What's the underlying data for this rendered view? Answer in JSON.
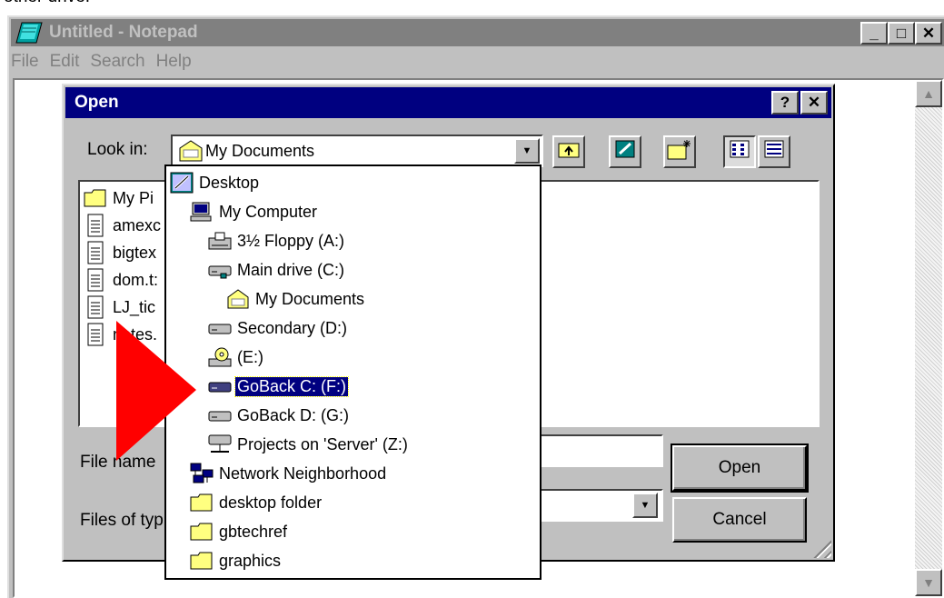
{
  "caption": "other drive.",
  "notepad": {
    "title": "Untitled - Notepad",
    "menu": [
      "File",
      "Edit",
      "Search",
      "Help"
    ],
    "window_buttons": [
      "_",
      "□",
      "✕"
    ]
  },
  "dialog": {
    "title": "Open",
    "title_buttons": [
      "?",
      "✕"
    ],
    "look_in_label": "Look in:",
    "look_in_value": "My Documents",
    "file_name_label": "File name",
    "files_of_type_label": "Files of typ",
    "open_button": "Open",
    "cancel_button": "Cancel",
    "files": [
      {
        "label": "My Pi",
        "icon": "folder-icon"
      },
      {
        "label": "amexc",
        "icon": "text-file-icon"
      },
      {
        "label": "bigtex",
        "icon": "text-file-icon"
      },
      {
        "label": "dom.t:",
        "icon": "text-file-icon"
      },
      {
        "label": "LJ_tic",
        "icon": "text-file-icon"
      },
      {
        "label": "notes.",
        "icon": "text-file-icon"
      }
    ]
  },
  "dropdown": {
    "items": [
      {
        "label": "Desktop",
        "icon": "desktop-icon",
        "indent": 0
      },
      {
        "label": "My Computer",
        "icon": "computer-icon",
        "indent": 1
      },
      {
        "label": "3½ Floppy (A:)",
        "icon": "floppy-drive-icon",
        "indent": 2
      },
      {
        "label": "Main drive (C:)",
        "icon": "hard-drive-icon",
        "indent": 2
      },
      {
        "label": "My Documents",
        "icon": "my-documents-icon",
        "indent": 3
      },
      {
        "label": "Secondary (D:)",
        "icon": "hard-drive-icon",
        "indent": 2
      },
      {
        "label": "(E:)",
        "icon": "cd-drive-icon",
        "indent": 2
      },
      {
        "label": "GoBack C: (F:)",
        "icon": "hard-drive-icon",
        "indent": 2,
        "selected": true
      },
      {
        "label": "GoBack D: (G:)",
        "icon": "hard-drive-icon",
        "indent": 2
      },
      {
        "label": "Projects on 'Server' (Z:)",
        "icon": "network-drive-icon",
        "indent": 2
      },
      {
        "label": "Network Neighborhood",
        "icon": "network-neighborhood-icon",
        "indent": 1
      },
      {
        "label": "desktop folder",
        "icon": "folder-icon",
        "indent": 1
      },
      {
        "label": "gbtechref",
        "icon": "folder-icon",
        "indent": 1
      },
      {
        "label": "graphics",
        "icon": "folder-icon",
        "indent": 1
      }
    ]
  },
  "colors": {
    "active_title": "#000080",
    "inactive_title": "#808080",
    "face": "#c0c0c0",
    "pointer": "#ff0000"
  }
}
